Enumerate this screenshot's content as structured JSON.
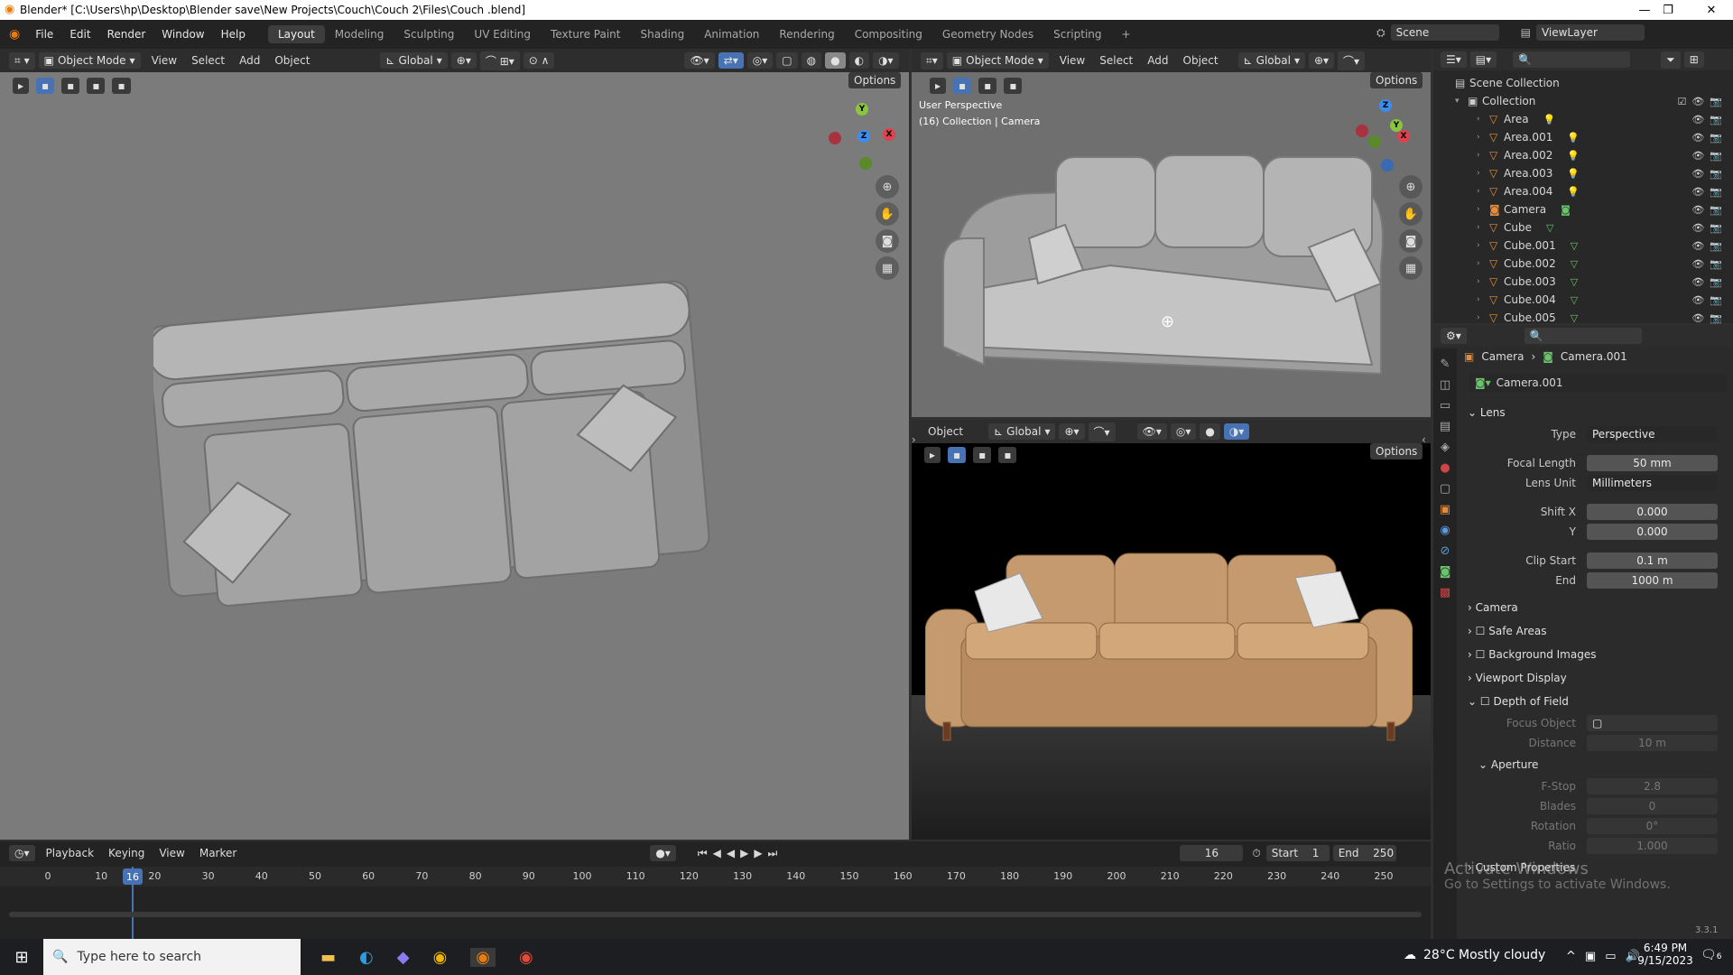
{
  "window": {
    "title": "Blender* [C:\\Users\\hp\\Desktop\\Blender save\\New Projects\\Couch\\Couch 2\\Files\\Couch .blend]",
    "minimize": "—",
    "maximize": "❐",
    "close": "✕"
  },
  "menu": [
    "File",
    "Edit",
    "Render",
    "Window",
    "Help"
  ],
  "workspaces": [
    "Layout",
    "Modeling",
    "Sculpting",
    "UV Editing",
    "Texture Paint",
    "Shading",
    "Animation",
    "Rendering",
    "Compositing",
    "Geometry Nodes",
    "Scripting"
  ],
  "add_workspace": "+",
  "scene": {
    "label": "Scene",
    "viewlayer": "ViewLayer"
  },
  "viewport_left": {
    "mode": "Object Mode",
    "menus": [
      "View",
      "Select",
      "Add",
      "Object"
    ],
    "transform": "Global",
    "options": "Options"
  },
  "viewport_right": {
    "mode": "Object Mode",
    "menus": [
      "View",
      "Select",
      "Add",
      "Object"
    ],
    "transform": "Global",
    "options": "Options",
    "perspective": "User Perspective",
    "collection_info": "(16) Collection | Camera"
  },
  "viewport_render": {
    "menu": "Object",
    "transform": "Global",
    "options": "Options"
  },
  "gizmo": {
    "x": "X",
    "y": "Y",
    "z": "Z"
  },
  "outliner": {
    "root": "Scene Collection",
    "collection": "Collection",
    "items": [
      {
        "name": "Area",
        "icon": "light-icon"
      },
      {
        "name": "Area.001",
        "icon": "light-icon"
      },
      {
        "name": "Area.002",
        "icon": "light-icon"
      },
      {
        "name": "Area.003",
        "icon": "light-icon"
      },
      {
        "name": "Area.004",
        "icon": "light-icon"
      },
      {
        "name": "Camera",
        "icon": "camera-icon"
      },
      {
        "name": "Cube",
        "icon": "mesh-icon"
      },
      {
        "name": "Cube.001",
        "icon": "mesh-icon"
      },
      {
        "name": "Cube.002",
        "icon": "mesh-icon"
      },
      {
        "name": "Cube.003",
        "icon": "mesh-icon"
      },
      {
        "name": "Cube.004",
        "icon": "mesh-icon"
      },
      {
        "name": "Cube.005",
        "icon": "mesh-icon"
      }
    ]
  },
  "properties": {
    "breadcrumb_a": "Camera",
    "breadcrumb_b": "Camera.001",
    "datablock": "Camera.001",
    "lens": {
      "title": "Lens",
      "type_label": "Type",
      "type_value": "Perspective",
      "focal_label": "Focal Length",
      "focal_value": "50 mm",
      "unit_label": "Lens Unit",
      "unit_value": "Millimeters",
      "shiftx_label": "Shift X",
      "shiftx_value": "0.000",
      "shifty_label": "Y",
      "shifty_value": "0.000",
      "clipstart_label": "Clip Start",
      "clipstart_value": "0.1 m",
      "clipend_label": "End",
      "clipend_value": "1000 m"
    },
    "panels": [
      "Camera",
      "Safe Areas",
      "Background Images",
      "Viewport Display"
    ],
    "dof": {
      "title": "Depth of Field",
      "focus_label": "Focus Object",
      "distance_label": "Distance",
      "distance_value": "10 m"
    },
    "aperture": {
      "title": "Aperture",
      "fstop_label": "F-Stop",
      "fstop_value": "2.8",
      "blades_label": "Blades",
      "blades_value": "0",
      "rotation_label": "Rotation",
      "rotation_value": "0°",
      "ratio_label": "Ratio",
      "ratio_value": "1.000"
    },
    "custom": "Custom Properties"
  },
  "timeline": {
    "menus": [
      "Playback",
      "Keying",
      "View",
      "Marker"
    ],
    "current_frame": "16",
    "start_label": "Start",
    "start": "1",
    "end_label": "End",
    "end": "250",
    "ticks": [
      "0",
      "10",
      "20",
      "30",
      "40",
      "50",
      "60",
      "70",
      "80",
      "90",
      "100",
      "110",
      "120",
      "130",
      "140",
      "150",
      "160",
      "170",
      "180",
      "190",
      "200",
      "210",
      "220",
      "230",
      "240",
      "250"
    ]
  },
  "watermark": {
    "line1": "Activate Windows",
    "line2": "Go to Settings to activate Windows."
  },
  "version": "3.3.1",
  "taskbar": {
    "search_placeholder": "Type here to search",
    "weather": "28°C  Mostly cloudy",
    "time": "6:49 PM",
    "date": "9/15/2023",
    "notif_count": "6"
  }
}
